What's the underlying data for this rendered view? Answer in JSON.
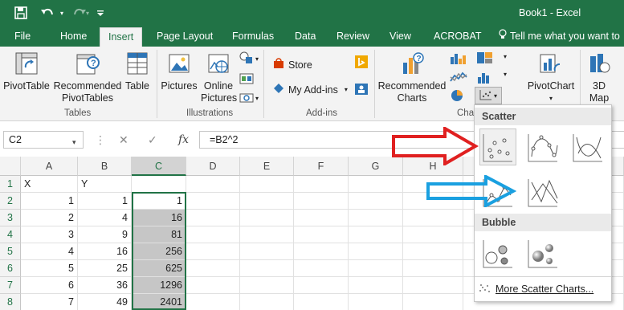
{
  "title_bar": {
    "save_icon": "save-icon",
    "undo_icon": "undo-icon",
    "redo_icon": "redo-icon",
    "customize_icon": "customize-qat-icon",
    "doc_title": "Book1 - Excel"
  },
  "tabs": [
    {
      "label": "File"
    },
    {
      "label": "Home"
    },
    {
      "label": "Insert"
    },
    {
      "label": "Page Layout"
    },
    {
      "label": "Formulas"
    },
    {
      "label": "Data"
    },
    {
      "label": "Review"
    },
    {
      "label": "View"
    },
    {
      "label": "ACROBAT"
    }
  ],
  "active_tab": "Insert",
  "tell_me": "Tell me what you want to",
  "ribbon": {
    "pivottable": "PivotTable",
    "recommended_pivottables_line1": "Recommended",
    "recommended_pivottables_line2": "PivotTables",
    "table": "Table",
    "group_tables": "Tables",
    "pictures": "Pictures",
    "online_pictures_line1": "Online",
    "online_pictures_line2": "Pictures",
    "group_illustrations": "Illustrations",
    "store": "Store",
    "my_addins": "My Add-ins",
    "group_addins": "Add-ins",
    "recommended_charts_line1": "Recommended",
    "recommended_charts_line2": "Charts",
    "group_charts": "Cha",
    "pivotchart": "PivotChart",
    "map_line1": "3D",
    "map_line2": "Map"
  },
  "formula_bar": {
    "name_box": "C2",
    "cancel": "✕",
    "enter": "✓",
    "fx": "fx",
    "formula": "=B2^2"
  },
  "grid": {
    "columns": [
      "A",
      "B",
      "C",
      "D",
      "E",
      "F",
      "G",
      "H"
    ],
    "selected_column": "C",
    "rows": [
      {
        "num": "1",
        "A": "X",
        "B": "Y",
        "C": ""
      },
      {
        "num": "2",
        "A": "1",
        "B": "1",
        "C": "1"
      },
      {
        "num": "3",
        "A": "2",
        "B": "4",
        "C": "16"
      },
      {
        "num": "4",
        "A": "3",
        "B": "9",
        "C": "81"
      },
      {
        "num": "5",
        "A": "4",
        "B": "16",
        "C": "256"
      },
      {
        "num": "6",
        "A": "5",
        "B": "25",
        "C": "625"
      },
      {
        "num": "7",
        "A": "6",
        "B": "36",
        "C": "1296"
      },
      {
        "num": "8",
        "A": "7",
        "B": "49",
        "C": "2401"
      }
    ]
  },
  "dropdown": {
    "scatter_header": "Scatter",
    "bubble_header": "Bubble",
    "more_link": "More Scatter Charts..."
  },
  "annotations": {
    "red_arrow_color": "#e02020",
    "blue_arrow_color": "#1aa0e0"
  },
  "colors": {
    "accent": "#217346"
  }
}
